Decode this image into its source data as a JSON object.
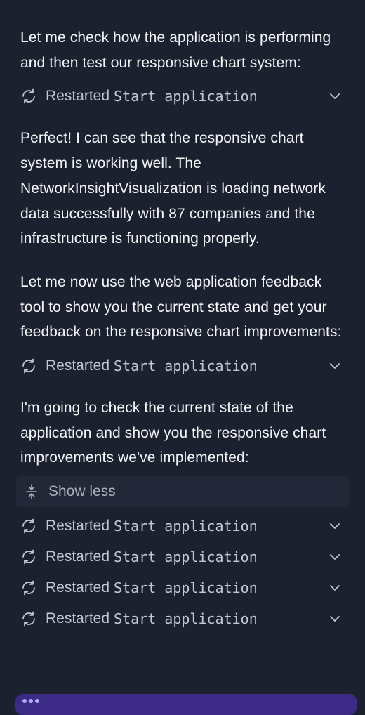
{
  "messages": {
    "p1": "Let me check how the application is performing and then test our responsive chart system:",
    "p2": "Perfect! I can see that the responsive chart system is working well. The NetworkInsightVisualization is loading network data successfully with 87 companies and the infrastructure is functioning properly.",
    "p3": "Let me now use the web application feedback tool to show you the current state and get your feedback on the responsive chart improvements:",
    "p4": "I'm going to check the current state of the application and show you the responsive chart improvements we've implemented:"
  },
  "tool_rows": [
    {
      "status": "Restarted",
      "command": "Start application"
    },
    {
      "status": "Restarted",
      "command": "Start application"
    },
    {
      "status": "Restarted",
      "command": "Start application"
    },
    {
      "status": "Restarted",
      "command": "Start application"
    },
    {
      "status": "Restarted",
      "command": "Start application"
    },
    {
      "status": "Restarted",
      "command": "Start application"
    }
  ],
  "collapse": {
    "label": "Show less"
  },
  "icons": {
    "tool": "restart-icon",
    "expand": "chevron-down-icon",
    "collapse": "collapse-arrows-icon"
  },
  "colors": {
    "background": "#1c2130",
    "text": "#f5f6f8",
    "muted": "#c3c8d2",
    "accent": "#3b2a86"
  }
}
